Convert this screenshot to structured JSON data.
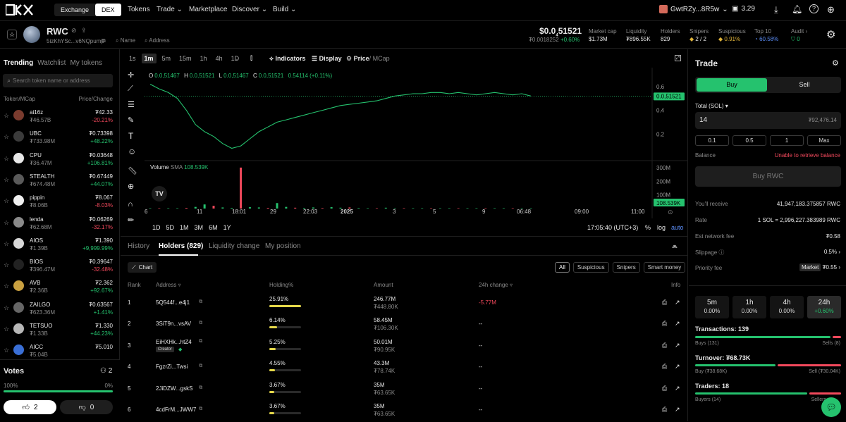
{
  "topbar": {
    "exchange": "Exchange",
    "dex": "DEX",
    "nav": [
      "Tokens",
      "Trade",
      "Marketplace",
      "Discover",
      "Build"
    ],
    "wallet": "GwtRZy...8R5w",
    "balance": "3.29"
  },
  "token": {
    "symbol": "RWC",
    "address": "5izKhYSc...v6NQpump",
    "search_name": "Name",
    "search_address": "Address",
    "price": "$0.0",
    "price_sub": "51521",
    "price_usd": "₮0.0018252",
    "price_change": "+0.60%",
    "stats": [
      {
        "label": "Market cap",
        "value": "$1.73M"
      },
      {
        "label": "Liquidity",
        "value": "₮896.55K"
      },
      {
        "label": "Holders",
        "value": "829"
      },
      {
        "label": "Snipers",
        "value": "2 / 2"
      },
      {
        "label": "Suspicious",
        "value": "0.91%"
      },
      {
        "label": "Top 10",
        "value": "60.58%"
      },
      {
        "label": "Audit",
        "value": "0"
      }
    ]
  },
  "sidebar": {
    "tabs": [
      "Trending",
      "Watchlist",
      "My tokens"
    ],
    "search_placeholder": "Search token name or address",
    "col_token": "Token/MCap",
    "col_price": "Price/Change",
    "items": [
      {
        "name": "ai16z",
        "mcap": "₮46.57B",
        "price": "₮42.33",
        "change": "-20.21%",
        "up": false,
        "color": "#7a3b2e"
      },
      {
        "name": "UBC",
        "mcap": "₮733.98M",
        "price": "₮0.73398",
        "change": "+48.22%",
        "up": true,
        "color": "#3b3b3b"
      },
      {
        "name": "CPU",
        "mcap": "₮36.47M",
        "price": "₮0.03648",
        "change": "+106.81%",
        "up": true,
        "color": "#e8e8e8"
      },
      {
        "name": "STEALTH",
        "mcap": "₮674.48M",
        "price": "₮0.67449",
        "change": "+44.07%",
        "up": true,
        "color": "#5a5a5a"
      },
      {
        "name": "pippin",
        "mcap": "₮8.06B",
        "price": "₮8.067",
        "change": "-8.03%",
        "up": false,
        "color": "#f0f0f0"
      },
      {
        "name": "lenda",
        "mcap": "₮62.68M",
        "price": "₮0.06269",
        "change": "-32.17%",
        "up": false,
        "color": "#8a8a8a"
      },
      {
        "name": "AIOS",
        "mcap": "₮1.39B",
        "price": "₮1.390",
        "change": "+9,999.99%",
        "up": true,
        "color": "#d8d8d8"
      },
      {
        "name": "BIOS",
        "mcap": "₮396.47M",
        "price": "₮0.39647",
        "change": "-32.48%",
        "up": false,
        "color": "#222222"
      },
      {
        "name": "AVB",
        "mcap": "₮2.36B",
        "price": "₮2.362",
        "change": "+92.67%",
        "up": true,
        "color": "#c9a040"
      },
      {
        "name": "ZAILGO",
        "mcap": "₮623.36M",
        "price": "₮0.63567",
        "change": "+1.41%",
        "up": true,
        "color": "#666666"
      },
      {
        "name": "TETSUO",
        "mcap": "₮1.33B",
        "price": "₮1.330",
        "change": "+44.23%",
        "up": true,
        "color": "#b7b7b7"
      },
      {
        "name": "AICC",
        "mcap": "₮5.04B",
        "price": "₮5.010",
        "change": "",
        "up": true,
        "color": "#3a6fd6"
      }
    ],
    "votes_label": "Votes",
    "votes_count": "2",
    "votes_left_pct": "100%",
    "votes_right_pct": "0%",
    "votes_level": 1.0,
    "likes": "2",
    "dislikes": "0"
  },
  "chart_toolbar": {
    "intervals": [
      "1s",
      "1m",
      "5m",
      "15m",
      "1h",
      "4h",
      "1D"
    ],
    "active_interval": "1m",
    "indicators": "Indicators",
    "display": "Display",
    "price": "Price",
    "mcap": "/ MCap"
  },
  "ohlc": {
    "o_label": "O",
    "o": "0.0,51467",
    "h_label": "H",
    "h": "0.0,51521",
    "l_label": "L",
    "l": "0.0,51467",
    "c_label": "C",
    "c": "0.0,51521",
    "chg": "0.54114 (+0.11%)"
  },
  "chart_data": {
    "type": "line",
    "price_ticks": [
      "0.6",
      "0.4",
      "0.2"
    ],
    "price_current": "0.0,51521",
    "volume_label": "Volume",
    "volume_sma_label": "SMA",
    "volume_sma": "108.539K",
    "volume_ticks": [
      "300M",
      "200M",
      "100M"
    ],
    "volume_current": "108.539K",
    "x_ticks": [
      "6",
      "11",
      "18:01",
      "29",
      "22:03",
      "2025",
      "3",
      "5",
      "9",
      "06:48",
      "09:00",
      "11:00"
    ],
    "series": [
      {
        "values": [
          0.62,
          0.58,
          0.55,
          0.5,
          0.4,
          0.28,
          0.22,
          0.18,
          0.12,
          0.08,
          0.1,
          0.16,
          0.22,
          0.26,
          0.3,
          0.32,
          0.34,
          0.36,
          0.38,
          0.4,
          0.42,
          0.44,
          0.45,
          0.46,
          0.47,
          0.48,
          0.5,
          0.52,
          0.53,
          0.54,
          0.54,
          0.55,
          0.55,
          0.54,
          0.55,
          0.54,
          0.53,
          0.54,
          0.55,
          0.54,
          0.53,
          0.54,
          0.52
        ]
      }
    ],
    "volume": [
      0,
      0,
      0,
      0,
      5,
      12,
      30,
      20,
      8,
      5,
      300,
      10,
      8,
      5,
      40,
      12,
      6,
      5,
      8,
      4,
      10,
      6,
      8,
      4,
      3,
      2,
      6,
      3,
      2,
      2,
      1,
      2,
      1,
      2,
      1,
      1,
      2,
      1,
      1,
      1,
      1,
      1,
      1
    ]
  },
  "range_bar": {
    "ranges": [
      "1D",
      "5D",
      "1M",
      "3M",
      "6M",
      "1Y"
    ],
    "time": "17:05:40 (UTC+3)",
    "pct": "%",
    "log": "log",
    "auto": "auto"
  },
  "holders_panel": {
    "tabs": [
      "History",
      "Holders (829)",
      "Liquidity change",
      "My position"
    ],
    "active_tab": "Holders (829)",
    "chart_btn": "Chart",
    "filters": [
      "All",
      "Suspicious",
      "Snipers",
      "Smart money"
    ],
    "columns": [
      "Rank",
      "Address",
      "Holding%",
      "Amount",
      "24h change",
      "Info"
    ],
    "rows": [
      {
        "rank": "1",
        "address": "5Q544f...e4j1",
        "tag": "",
        "holding": "25.91%",
        "level": 0.26,
        "amount": "246.77M",
        "amount_usd": "₮448.80K",
        "change": "-5.77M",
        "neg": true
      },
      {
        "rank": "2",
        "address": "3SiT9n...vsAV",
        "tag": "",
        "holding": "6.14%",
        "level": 0.06,
        "amount": "58.45M",
        "amount_usd": "₮106.30K",
        "change": "--",
        "neg": false
      },
      {
        "rank": "3",
        "address": "EiHXHk...htZ4",
        "tag": "Creator",
        "holding": "5.25%",
        "level": 0.05,
        "amount": "50.01M",
        "amount_usd": "₮90.95K",
        "change": "--",
        "neg": false
      },
      {
        "rank": "4",
        "address": "FgzrZi...Twsi",
        "tag": "",
        "holding": "4.55%",
        "level": 0.045,
        "amount": "43.3M",
        "amount_usd": "₮78.74K",
        "change": "--",
        "neg": false
      },
      {
        "rank": "5",
        "address": "2JiDZW...gskS",
        "tag": "",
        "holding": "3.67%",
        "level": 0.037,
        "amount": "35M",
        "amount_usd": "₮63.65K",
        "change": "--",
        "neg": false
      },
      {
        "rank": "6",
        "address": "4cdFrM...JWW7",
        "tag": "",
        "holding": "3.67%",
        "level": 0.037,
        "amount": "35M",
        "amount_usd": "₮63.65K",
        "change": "--",
        "neg": false
      }
    ]
  },
  "trade": {
    "title": "Trade",
    "buy": "Buy",
    "sell": "Sell",
    "total_label": "Total (SOL)",
    "amount": "14",
    "amount_usd": "₮92,476.14",
    "quick": [
      "0.1",
      "0.5",
      "1",
      "Max"
    ],
    "balance_label": "Balance",
    "balance_err": "Unable to retrieve balance",
    "submit": "Buy RWC",
    "receive_label": "You'll receive",
    "receive": "41,947,183.375857 RWC",
    "rate_label": "Rate",
    "rate": "1 SOL = 2,996,227.383989 RWC",
    "fee_label": "Est network fee",
    "fee": "₮0.58",
    "slippage_label": "Slippage",
    "slippage": "0.5%",
    "priority_label": "Priority fee",
    "priority_mode": "Market",
    "priority": "₮0.55"
  },
  "stats_panel": {
    "periods": [
      {
        "label": "5m",
        "value": "0.00%",
        "active": false
      },
      {
        "label": "1h",
        "value": "0.00%",
        "active": false
      },
      {
        "label": "4h",
        "value": "0.00%",
        "active": false
      },
      {
        "label": "24h",
        "value": "+0.60%",
        "active": true
      }
    ],
    "transactions": "Transactions: 139",
    "buys": "Buys (131)",
    "sells": "Sells (8)",
    "tx_buy_frac": 0.94,
    "turnover": "Turnover: ₮68.73K",
    "turn_buy": "Buy (₮38.68K)",
    "turn_sell": "Sell (₮30.04K)",
    "turn_buy_frac": 0.56,
    "traders": "Traders: 18",
    "buyers": "Buyers (14)",
    "sellers": "Sellers",
    "traders_buy_frac": 0.78
  }
}
